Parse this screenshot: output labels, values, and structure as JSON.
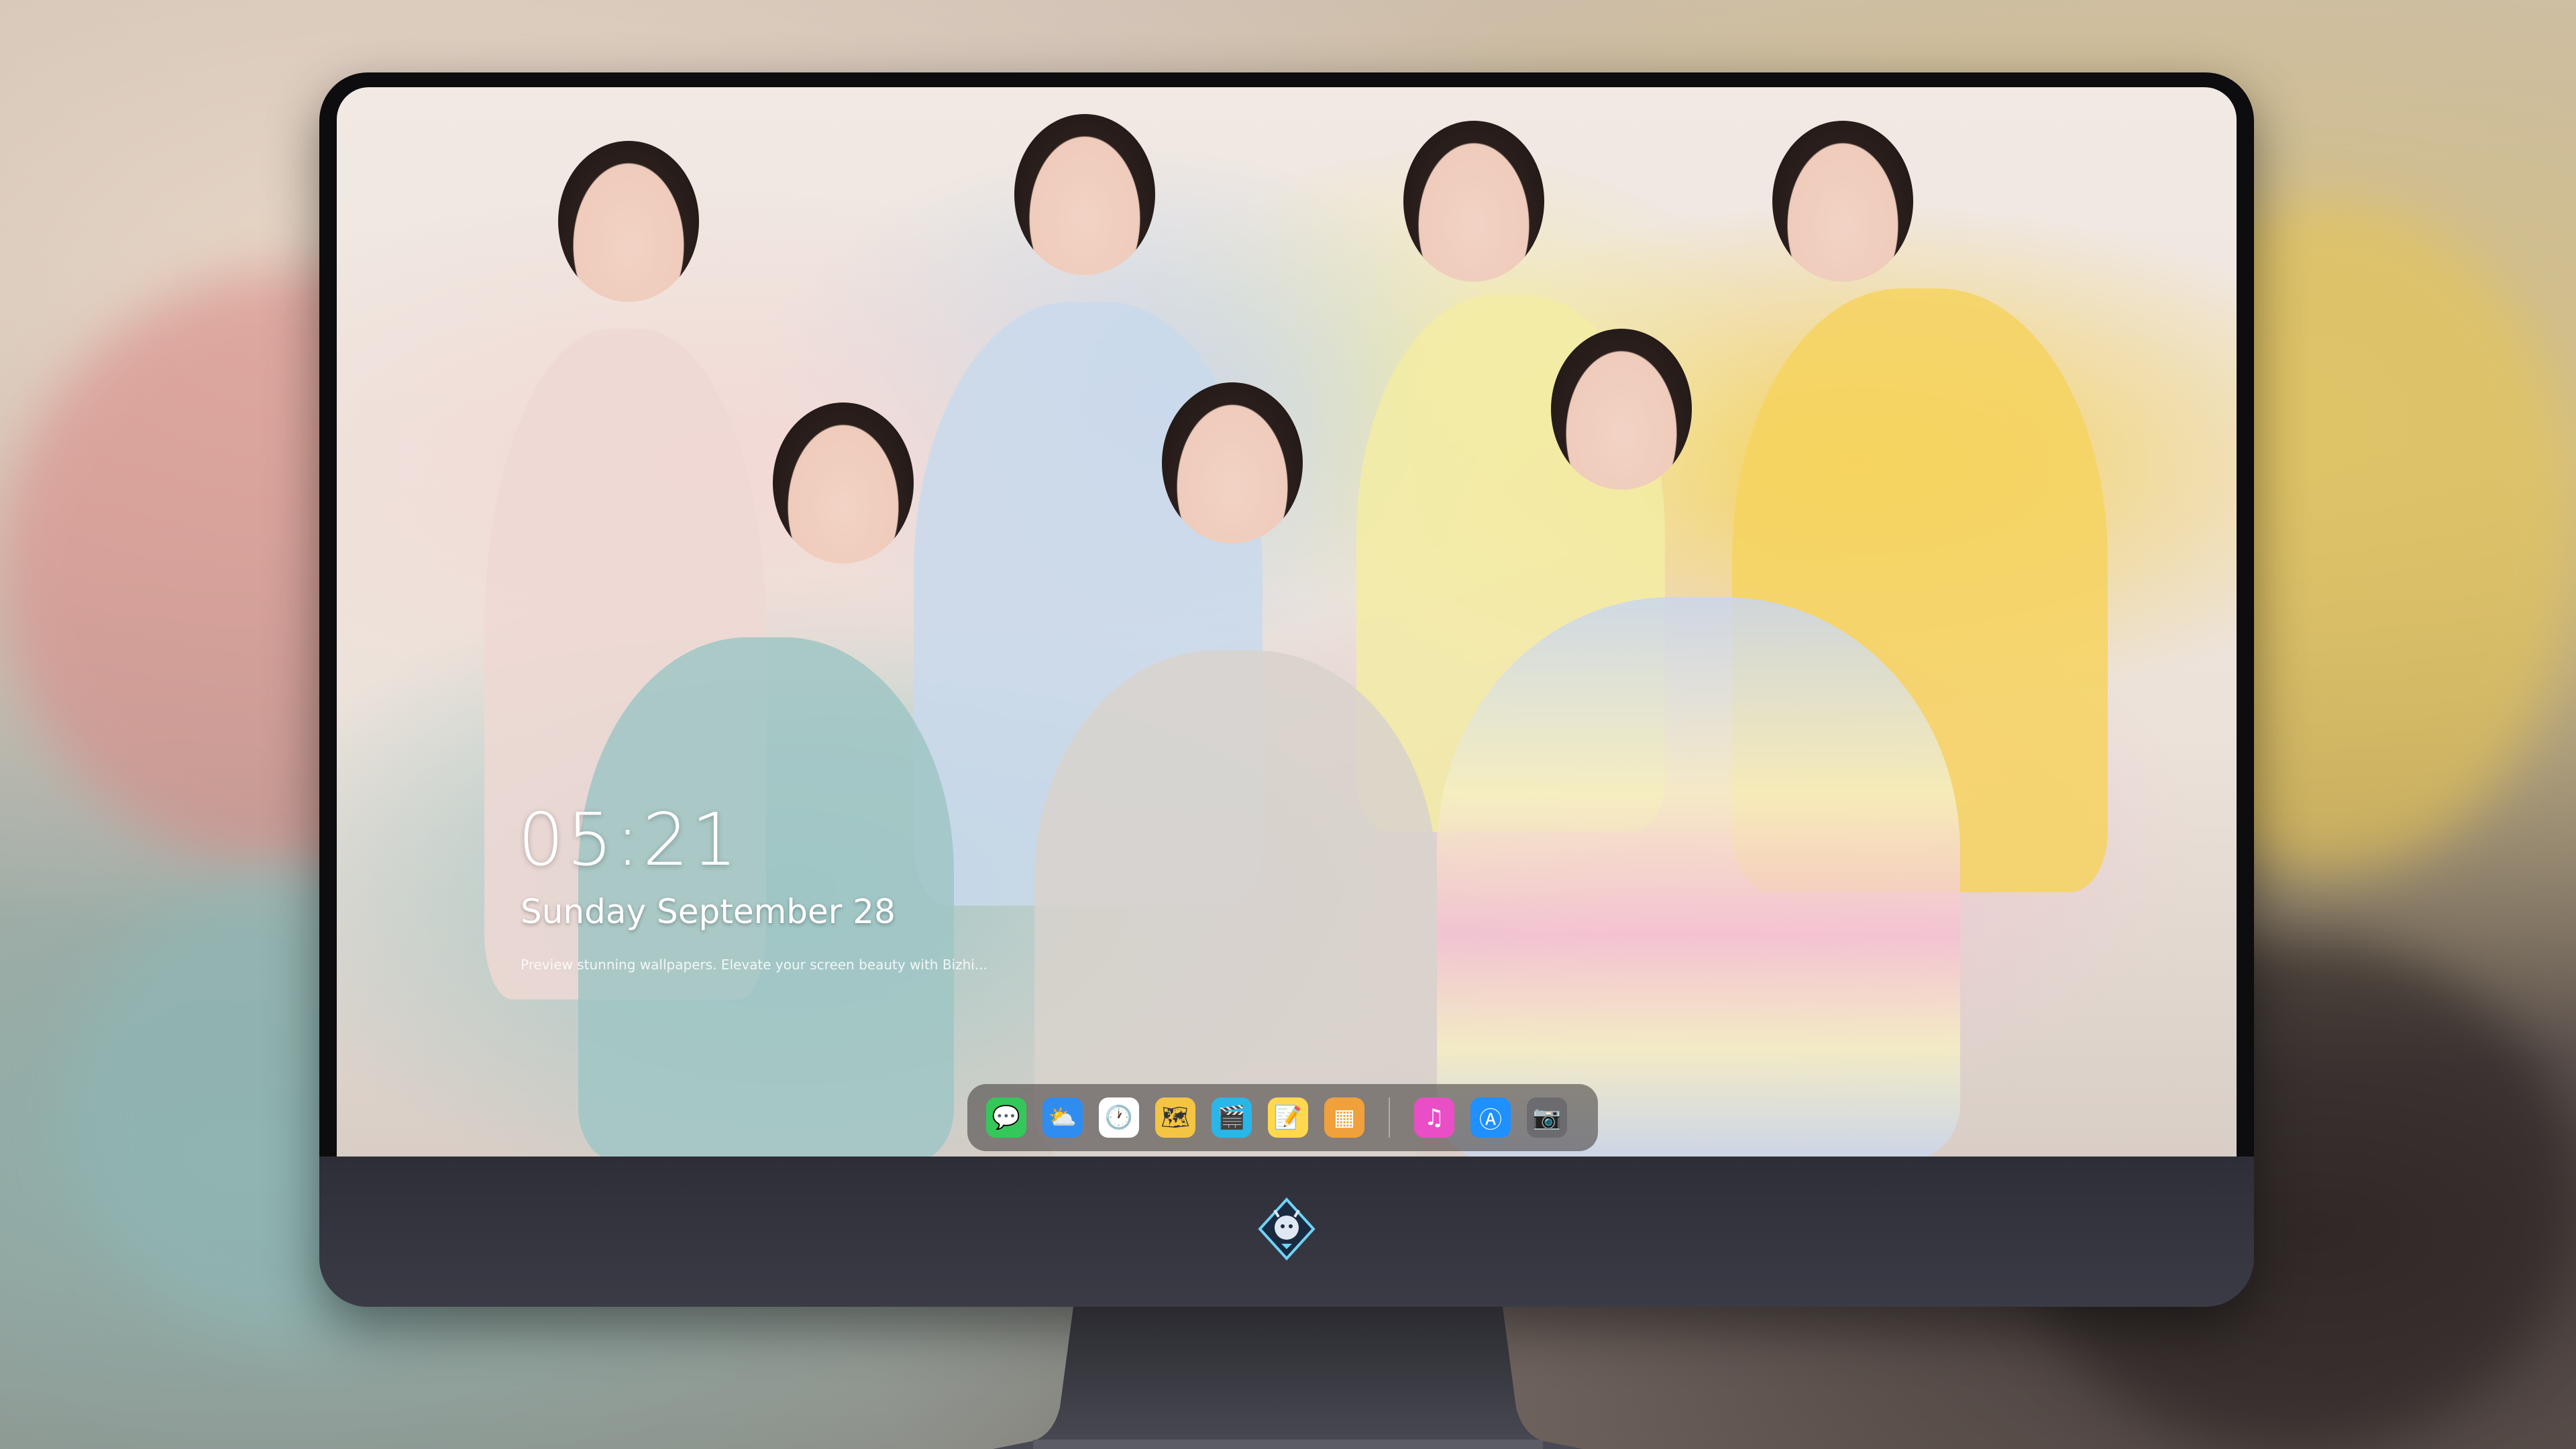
{
  "lockscreen": {
    "time": "05:21",
    "date": "Sunday September  28",
    "tagline": "Preview stunning wallpapers. Elevate your screen beauty with Bizhi..."
  },
  "dock": {
    "apps": [
      {
        "name": "messages",
        "color": "#34c759",
        "glyph": "💬"
      },
      {
        "name": "weather",
        "color": "#2f8cf0",
        "glyph": "⛅"
      },
      {
        "name": "clock",
        "color": "#ffffff",
        "glyph": "🕐"
      },
      {
        "name": "maps",
        "color": "#f4c542",
        "glyph": "🗺"
      },
      {
        "name": "clapper",
        "color": "#29b6e8",
        "glyph": "🎬"
      },
      {
        "name": "notes",
        "color": "#ffd84d",
        "glyph": "📝"
      },
      {
        "name": "photos-grid",
        "color": "#f0a13b",
        "glyph": "▦"
      },
      {
        "name": "music",
        "color": "#e94ec6",
        "glyph": "♫"
      },
      {
        "name": "app-store",
        "color": "#1e90ff",
        "glyph": "Ⓐ"
      },
      {
        "name": "camera",
        "color": "#6b6b70",
        "glyph": "📷"
      }
    ]
  },
  "colors": {
    "chin": "#33333d",
    "bezel": "#0d0d0f"
  }
}
